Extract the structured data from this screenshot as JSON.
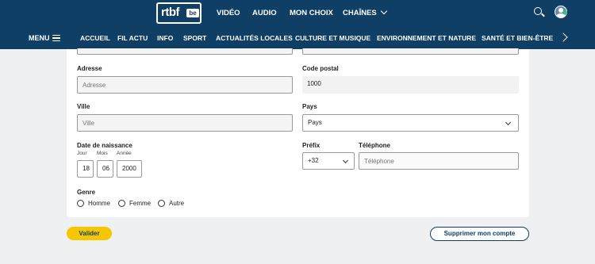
{
  "header": {
    "logo_text": "rtbf",
    "logo_badge": "be",
    "top_links": [
      {
        "label": "VIDÉO"
      },
      {
        "label": "AUDIO"
      },
      {
        "label": "MON CHOIX"
      },
      {
        "label": "CHAÎNES"
      }
    ],
    "menu_label": "MENU",
    "nav_links": [
      {
        "label": "ACCUEIL"
      },
      {
        "label": "FIL ACTU"
      },
      {
        "label": "INFO"
      },
      {
        "label": "SPORT"
      },
      {
        "label": "ACTUALITÉS LOCALES"
      },
      {
        "label": "CULTURE ET MUSIQUE"
      },
      {
        "label": "ENVIRONNEMENT ET NATURE"
      },
      {
        "label": "SANTÉ ET BIEN-ÊTRE"
      }
    ],
    "icons": [
      "search-icon",
      "avatar",
      "chevron-right-icon",
      "chevron-down-icon",
      "hamburger-icon"
    ]
  },
  "form": {
    "address": {
      "label": "Adresse",
      "placeholder": "Adresse",
      "value": ""
    },
    "postal_code": {
      "label": "Code postal",
      "value": "1000"
    },
    "city": {
      "label": "Ville",
      "placeholder": "Ville",
      "value": ""
    },
    "country": {
      "label": "Pays",
      "selected": "Pays"
    },
    "birth": {
      "label": "Date de naissance",
      "day_label": "Jour",
      "day_value": "18",
      "month_label": "Mois",
      "month_value": "06",
      "year_label": "Année",
      "year_value": "2000"
    },
    "prefix": {
      "label": "Préfix",
      "selected": "+32"
    },
    "phone": {
      "label": "Téléphone",
      "placeholder": "Téléphone",
      "value": ""
    },
    "gender": {
      "label": "Genre",
      "options": [
        {
          "label": "Homme"
        },
        {
          "label": "Femme"
        },
        {
          "label": "Autre"
        }
      ]
    }
  },
  "actions": {
    "submit_label": "Valider",
    "delete_label": "Supprimer mon compte"
  },
  "colors": {
    "header_bg": "#0f3f64",
    "accent_yellow": "#f6c700",
    "page_bg": "#eef0f2"
  }
}
